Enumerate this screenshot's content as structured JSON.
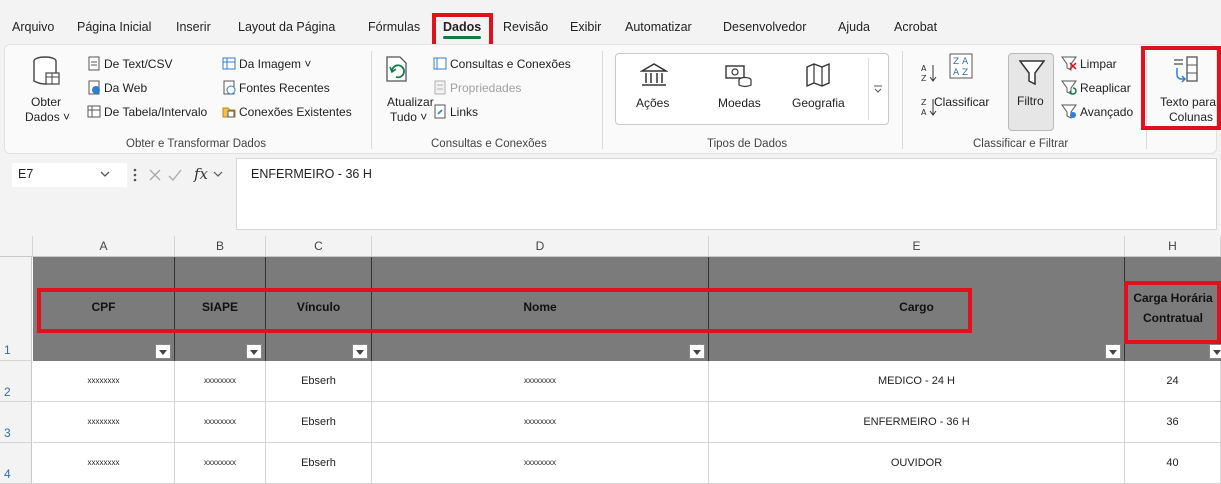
{
  "menu": {
    "items": [
      "Arquivo",
      "Página Inicial",
      "Inserir",
      "Layout da Página",
      "Fórmulas",
      "Dados",
      "Revisão",
      "Exibir",
      "Automatizar",
      "Desenvolvedor",
      "Ajuda",
      "Acrobat"
    ],
    "active": "Dados"
  },
  "ribbon": {
    "obter": {
      "big_label_1": "Obter",
      "big_label_2": "Dados ˅",
      "text_csv": "De Text/CSV",
      "web": "Da Web",
      "tabela": "De Tabela/Intervalo",
      "imagem": "Da Imagem ˅",
      "fontes": "Fontes Recentes",
      "conexoes": "Conexões Existentes",
      "group": "Obter e Transformar Dados"
    },
    "consultas": {
      "atualizar_1": "Atualizar",
      "atualizar_2": "Tudo ˅",
      "consultas": "Consultas e Conexões",
      "propriedades": "Propriedades",
      "links": "Links",
      "group": "Consultas e Conexões"
    },
    "tipos": {
      "acoes": "Ações",
      "moedas": "Moedas",
      "geografia": "Geografia",
      "group": "Tipos de Dados"
    },
    "classificar": {
      "classificar": "Classificar",
      "filtro": "Filtro",
      "limpar": "Limpar",
      "reaplicar": "Reaplicar",
      "avancado": "Avançado",
      "group": "Classificar e Filtrar"
    },
    "ferramentas": {
      "texto_1": "Texto para",
      "texto_2": "Colunas"
    }
  },
  "formula_bar": {
    "name_box": "E7",
    "formula": "ENFERMEIRO - 36 H"
  },
  "sheet": {
    "columns": [
      "A",
      "B",
      "C",
      "D",
      "E",
      "H"
    ],
    "rows": [
      "1",
      "2",
      "3",
      "4"
    ],
    "headers": {
      "cpf": "CPF",
      "siape": "SIAPE",
      "vinculo": "Vínculo",
      "nome": "Nome",
      "cargo": "Cargo",
      "carga_1": "Carga Horária",
      "carga_2": "Contratual"
    },
    "data": [
      [
        "xxxxxxxx",
        "xxxxxxxx",
        "Ebserh",
        "xxxxxxxx",
        "MEDICO - 24 H",
        "24"
      ],
      [
        "xxxxxxxx",
        "xxxxxxxx",
        "Ebserh",
        "xxxxxxxx",
        "ENFERMEIRO - 36 H",
        "36"
      ],
      [
        "xxxxxxxx",
        "xxxxxxxx",
        "Ebserh",
        "xxxxxxxx",
        "OUVIDOR",
        "40"
      ]
    ]
  },
  "colors": {
    "excel_green": "#107c41",
    "highlight_red": "#e0101c",
    "header_fill": "#7b7b7b"
  }
}
